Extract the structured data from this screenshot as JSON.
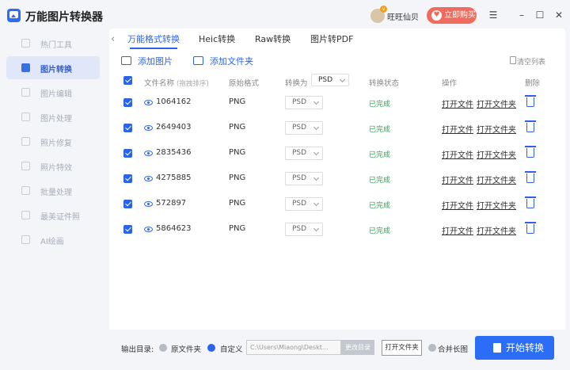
{
  "app": {
    "title": "万能图片转换器"
  },
  "header": {
    "user_name": "旺旺仙贝",
    "vip_label": "立即购买",
    "menu_icon": "menu-icon",
    "min_icon": "minimize-icon",
    "max_icon": "maximize-icon",
    "close_icon": "close-icon"
  },
  "sidebar": {
    "items": [
      {
        "label": "热门工具",
        "active": false
      },
      {
        "label": "图片转换",
        "active": true
      },
      {
        "label": "图片编辑",
        "active": false
      },
      {
        "label": "图片处理",
        "active": false
      },
      {
        "label": "照片修复",
        "active": false
      },
      {
        "label": "照片特效",
        "active": false
      },
      {
        "label": "批量处理",
        "active": false
      },
      {
        "label": "最美证件照",
        "active": false
      },
      {
        "label": "AI绘画",
        "active": false
      }
    ]
  },
  "tabs": [
    {
      "label": "万能格式转换",
      "active": true
    },
    {
      "label": "Heic转换",
      "active": false
    },
    {
      "label": "Raw转换",
      "active": false
    },
    {
      "label": "图片转PDF",
      "active": false
    }
  ],
  "toolbar": {
    "add_image": "添加图片",
    "add_folder": "添加文件夹",
    "clear_list": "清空列表"
  },
  "table": {
    "headers": {
      "filename": "文件名称",
      "filename_sub": "(拖拽排序)",
      "format": "原始格式",
      "convert_to": "转换为",
      "convert_value": "PSD",
      "status": "转换状态",
      "action": "操作",
      "delete": "删除"
    },
    "rows": [
      {
        "name": "1064162",
        "format": "PNG",
        "target": "PSD",
        "status": "已完成",
        "open_file": "打开文件",
        "open_folder": "打开文件夹"
      },
      {
        "name": "2649403",
        "format": "PNG",
        "target": "PSD",
        "status": "已完成",
        "open_file": "打开文件",
        "open_folder": "打开文件夹"
      },
      {
        "name": "2835436",
        "format": "PNG",
        "target": "PSD",
        "status": "已完成",
        "open_file": "打开文件",
        "open_folder": "打开文件夹"
      },
      {
        "name": "4275885",
        "format": "PNG",
        "target": "PSD",
        "status": "已完成",
        "open_file": "打开文件",
        "open_folder": "打开文件夹"
      },
      {
        "name": "572897",
        "format": "PNG",
        "target": "PSD",
        "status": "已完成",
        "open_file": "打开文件",
        "open_folder": "打开文件夹"
      },
      {
        "name": "5864623",
        "format": "PNG",
        "target": "PSD",
        "status": "已完成",
        "open_file": "打开文件",
        "open_folder": "打开文件夹"
      }
    ]
  },
  "bottom": {
    "output_label": "输出目录:",
    "original_folder": "原文件夹",
    "custom": "自定义",
    "path": "C:\\Users\\Miaong\\Deskt...",
    "change_dir": "更改目录",
    "open_folder": "打开文件夹",
    "merge": "合并长图",
    "start": "开始转换"
  },
  "colors": {
    "accent": "#2b64e8",
    "success": "#2ea44f",
    "vip": "#ee6b5d"
  }
}
